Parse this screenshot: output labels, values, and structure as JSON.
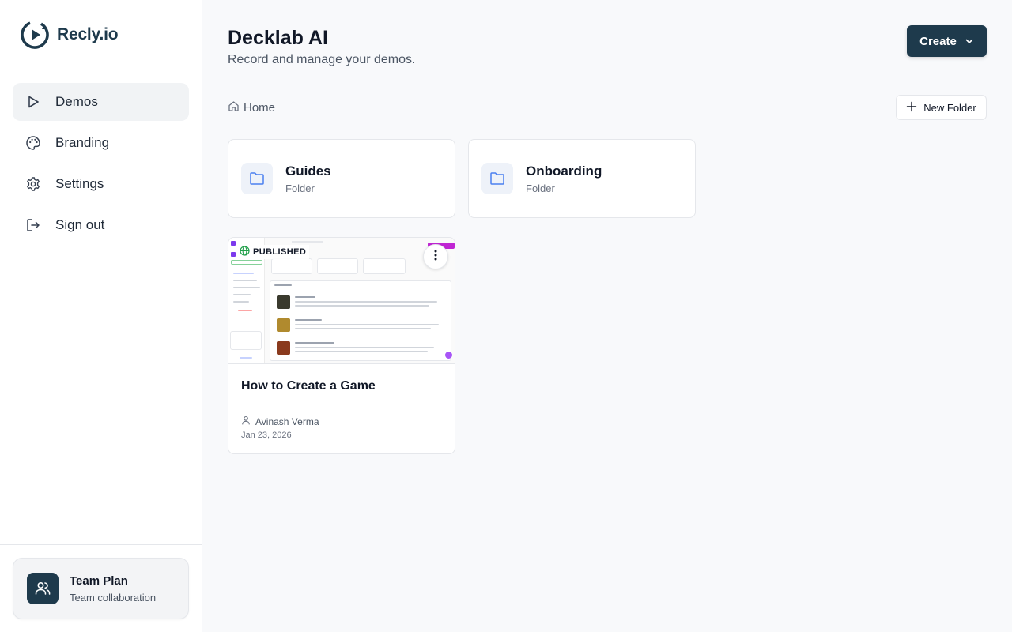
{
  "brand": {
    "name": "Recly.io"
  },
  "sidebar": {
    "items": [
      {
        "label": "Demos",
        "icon": "play-icon",
        "active": true
      },
      {
        "label": "Branding",
        "icon": "palette-icon",
        "active": false
      },
      {
        "label": "Settings",
        "icon": "gear-icon",
        "active": false
      },
      {
        "label": "Sign out",
        "icon": "sign-out-icon",
        "active": false
      }
    ],
    "plan": {
      "title": "Team Plan",
      "subtitle": "Team collaboration",
      "icon": "users-icon"
    }
  },
  "header": {
    "title": "Decklab AI",
    "subtitle": "Record and manage your demos.",
    "create_label": "Create"
  },
  "breadcrumb": {
    "home": "Home"
  },
  "toolbar": {
    "new_folder_label": "New Folder"
  },
  "folders": [
    {
      "name": "Guides",
      "type": "Folder"
    },
    {
      "name": "Onboarding",
      "type": "Folder"
    }
  ],
  "demos": [
    {
      "title": "How to Create a Game",
      "status": "PUBLISHED",
      "author": "Avinash Verma",
      "date": "Jan 23, 2026"
    }
  ],
  "colors": {
    "accent": "#1e3a4c",
    "folder_icon": "#4a7ff0",
    "published_green": "#22a04b"
  }
}
